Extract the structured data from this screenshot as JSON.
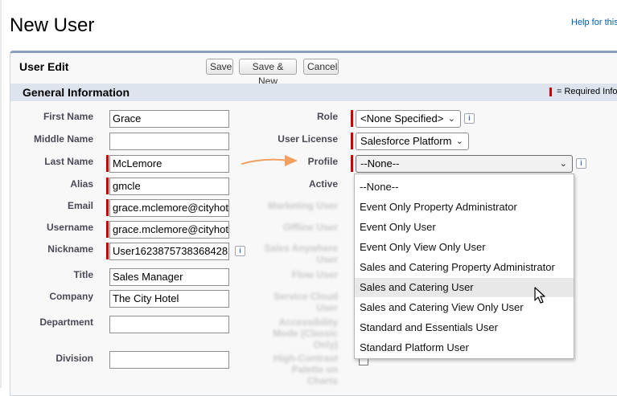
{
  "header": {
    "title": "New User",
    "help_link": "Help for this"
  },
  "panel": {
    "title": "User Edit",
    "buttons": {
      "save": "Save",
      "save_new": "Save & New",
      "cancel": "Cancel"
    }
  },
  "section": {
    "title": "General Information",
    "required_legend": "= Required Info"
  },
  "left_fields": {
    "first_name": {
      "label": "First Name",
      "value": "Grace"
    },
    "middle_name": {
      "label": "Middle Name",
      "value": ""
    },
    "last_name": {
      "label": "Last Name",
      "value": "McLemore"
    },
    "alias": {
      "label": "Alias",
      "value": "gmcle"
    },
    "email": {
      "label": "Email",
      "value": "grace.mclemore@cityhot"
    },
    "username": {
      "label": "Username",
      "value": "grace.mclemore@cityhot"
    },
    "nickname": {
      "label": "Nickname",
      "value": "User1623875738368428"
    },
    "title": {
      "label": "Title",
      "value": "Sales Manager"
    },
    "company": {
      "label": "Company",
      "value": "The City Hotel"
    },
    "department": {
      "label": "Department",
      "value": ""
    },
    "division": {
      "label": "Division",
      "value": ""
    }
  },
  "right_fields": {
    "role": {
      "label": "Role",
      "value": "<None Specified>"
    },
    "user_license": {
      "label": "User License",
      "value": "Salesforce Platform"
    },
    "profile": {
      "label": "Profile",
      "value": "--None--"
    },
    "active": {
      "label": "Active"
    },
    "marketing_user": {
      "label": "Marketing User"
    },
    "offline_user": {
      "label": "Offline User"
    },
    "sales_anywhere_user": {
      "label": "Sales Anywhere User"
    },
    "flow_user": {
      "label": "Flow User"
    },
    "service_cloud_user": {
      "label": "Service Cloud User"
    },
    "accessibility_mode": {
      "label": "Accessibility Mode (Classic Only)"
    },
    "high_contrast_palette": {
      "label": "High-Contrast Palette on Charts"
    }
  },
  "profile_dropdown": {
    "options": [
      "--None--",
      "Event Only Property Administrator",
      "Event Only User",
      "Event Only View Only User",
      "Sales and Catering Property Administrator",
      "Sales and Catering User",
      "Sales and Catering View Only User",
      "Standard and Essentials User",
      "Standard Platform User"
    ],
    "highlighted": "Sales and Catering User"
  },
  "icons": {
    "info": "i",
    "chevron": "⌄"
  },
  "colors": {
    "required": "#cc0000",
    "arrow": "#f0a060",
    "section_bar": "#dde4ee"
  }
}
